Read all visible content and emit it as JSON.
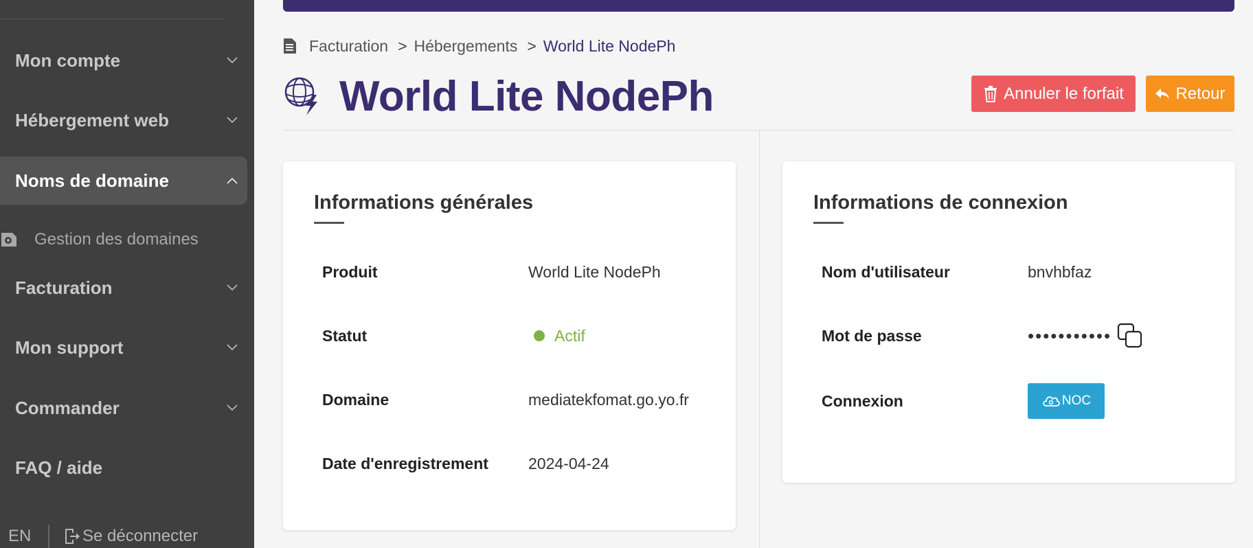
{
  "sidebar": {
    "items": [
      {
        "label": "Mon compte"
      },
      {
        "label": "Hébergement web"
      },
      {
        "label": "Noms de domaine"
      },
      {
        "label": "Facturation"
      },
      {
        "label": "Mon support"
      },
      {
        "label": "Commander"
      },
      {
        "label": "FAQ / aide"
      }
    ],
    "subitem": {
      "label": "Gestion des domaines",
      "icon": "gear-icon"
    },
    "footer": {
      "lang": "EN",
      "logout": "Se déconnecter"
    }
  },
  "breadcrumb": {
    "items": [
      "Facturation",
      "Hébergements",
      "World Lite NodePh"
    ],
    "separator": ">"
  },
  "page": {
    "title": "World Lite NodePh",
    "cancel_label": "Annuler le forfait",
    "back_label": "Retour"
  },
  "general": {
    "title": "Informations générales",
    "rows": [
      {
        "label": "Produit",
        "value": "World Lite NodePh"
      },
      {
        "label": "Statut",
        "value": "Actif"
      },
      {
        "label": "Domaine",
        "value": "mediatekfomat.go.yo.fr"
      },
      {
        "label": "Date d'enregistrement",
        "value": "2024-04-24"
      }
    ]
  },
  "connection": {
    "title": "Informations de connexion",
    "rows": [
      {
        "label": "Nom d'utilisateur",
        "value": "bnvhbfaz"
      },
      {
        "label": "Mot de passe",
        "value": "•••••••••••"
      },
      {
        "label": "Connexion",
        "value": "NOC"
      }
    ]
  },
  "colors": {
    "sidebar_bg": "#3f3f3f",
    "brand": "#3b2d6f",
    "danger": "#ee5b5f",
    "warning": "#f7921e",
    "success": "#7cb342",
    "info": "#2aa3d3"
  }
}
